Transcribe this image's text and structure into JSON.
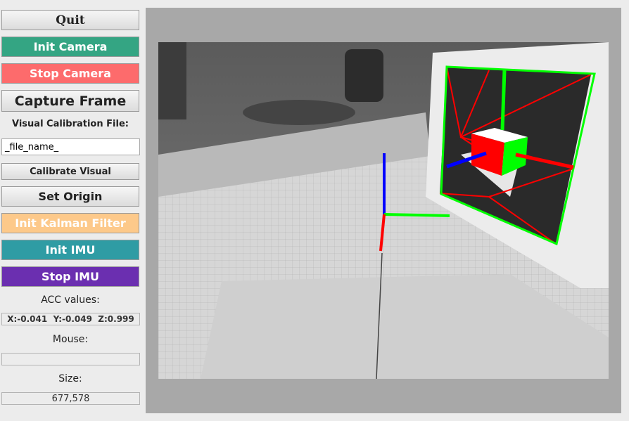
{
  "sidebar": {
    "quit_label": "Quit",
    "init_camera_label": "Init Camera",
    "stop_camera_label": "Stop Camera",
    "capture_frame_label": "Capture Frame",
    "visual_calibration_file_label": "Visual Calibration File:",
    "calibration_file_value": "_file_name_",
    "calibrate_visual_label": "Calibrate Visual",
    "set_origin_label": "Set Origin",
    "init_kalman_label": "Init Kalman Filter",
    "init_imu_label": "Init IMU",
    "stop_imu_label": "Stop IMU",
    "acc_label": "ACC values:",
    "acc_value": "X:-0.041  Y:-0.049  Z:0.999",
    "mouse_label": "Mouse:",
    "mouse_value": "",
    "size_label": "Size:",
    "size_value": "677,578"
  },
  "colors": {
    "init_camera": "#34a583",
    "stop_camera": "#fd6b6c",
    "init_kalman": "#fdc98a",
    "init_imu": "#2f9ca4",
    "stop_imu": "#6b2fb0",
    "axis_x": "#ff0000",
    "axis_y": "#00ff00",
    "axis_z": "#0000ff"
  }
}
